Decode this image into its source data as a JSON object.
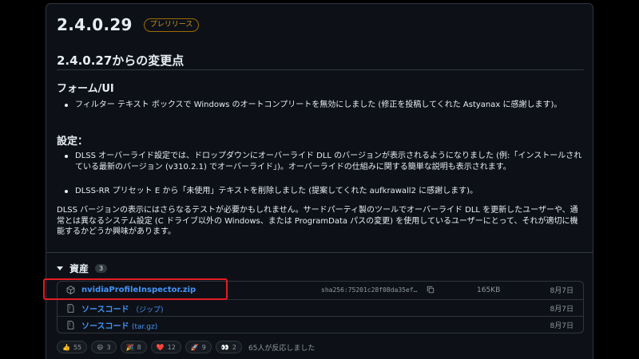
{
  "release": {
    "version": "2.4.0.29",
    "badge": "プレリリース",
    "changes_heading": "2.4.0.27からの変更点",
    "sections": [
      {
        "heading": "フォーム/UI",
        "bullets": [
          "フィルター テキスト ボックスで Windows のオートコンプリートを無効にしました (修正を投稿してくれた Astyanax に感謝します)。"
        ]
      },
      {
        "heading": "設定：",
        "bullets": [
          "DLSS オーバーライド設定では、ドロップダウンにオーバーライド DLL のバージョンが表示されるようになりました (例:「インストールされている最新のバージョン (v310.2.1) でオーバーライド」)。オーバーライドの仕組みに関する簡単な説明も表示されます。",
          "DLSS-RR プリセット E から「未使用」テキストを削除しました (提案してくれた aufkrawall2 に感謝します)。"
        ]
      }
    ],
    "paragraph": "DLSS バージョンの表示にはさらなるテストが必要かもしれません。サードパーティ製のツールでオーバーライド DLL を更新したユーザーや、通常とは異なるシステム設定 (C ドライブ以外の Windows、または ProgramData パスの変更) を使用しているユーザーにとって、それが適切に機能するかどうか興味があります。"
  },
  "assets": {
    "title": "資産",
    "count": "3",
    "items": [
      {
        "name": "nvidiaProfileInspector.zip",
        "sha": "sha256:75201c28f08da35ef…",
        "size": "165KB",
        "date": "8月7日"
      },
      {
        "name": "ソースコード",
        "suffix": "（ジップ)",
        "date": "8月7日"
      },
      {
        "name": "ソースコード",
        "suffix": "(tar.gz)",
        "date": "8月7日"
      }
    ]
  },
  "reactions": {
    "items": [
      {
        "emoji": "👍",
        "count": "55"
      },
      {
        "emoji": "😄",
        "count": "3"
      },
      {
        "emoji": "🎉",
        "count": "8"
      },
      {
        "emoji": "❤️",
        "count": "12"
      },
      {
        "emoji": "🚀",
        "count": "9"
      },
      {
        "emoji": "👀",
        "count": "2"
      }
    ],
    "summary": "65人が反応しました"
  },
  "colors": {
    "background": "#0d1117",
    "link": "#4493f8",
    "badge": "#d29922",
    "highlight": "#e51c23"
  },
  "icons": [
    "package-icon",
    "file-zip-icon",
    "copy-icon",
    "caret-down-icon"
  ]
}
